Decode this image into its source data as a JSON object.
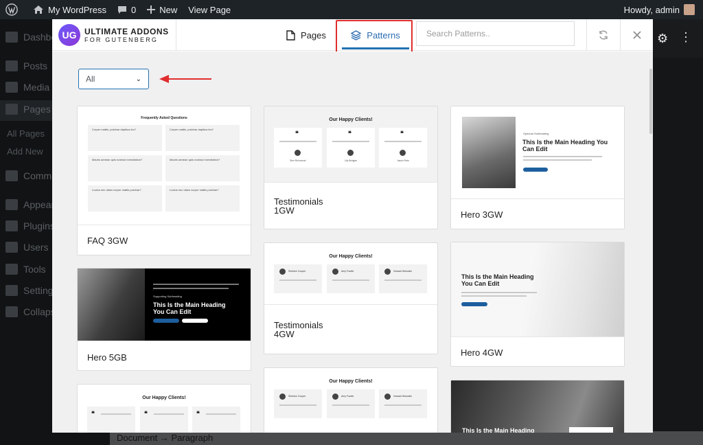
{
  "admin_bar": {
    "site_name": "My WordPress",
    "comments_count": "0",
    "new_label": "New",
    "view_label": "View Page",
    "greeting": "Howdy, admin"
  },
  "admin_menu": {
    "items": [
      "Dashboard",
      "Posts",
      "Media",
      "Pages",
      "Comments",
      "Appearance",
      "Plugins",
      "Users",
      "Tools",
      "Settings",
      "Collapse menu"
    ],
    "sub_items": [
      "All Pages",
      "Add New"
    ]
  },
  "editor": {
    "breadcrumb": "Document → Paragraph"
  },
  "modal": {
    "logo_badge": "UG",
    "logo_line1": "ULTIMATE ADDONS",
    "logo_line2": "FOR GUTENBERG",
    "tabs": [
      {
        "label": "Pages",
        "icon": "page-icon"
      },
      {
        "label": "Patterns",
        "icon": "layers-icon",
        "active": true
      }
    ],
    "search_placeholder": "Search Patterns..",
    "filter_value": "All",
    "highlight_color": "#e02d2d",
    "accent_color": "#2271b1"
  },
  "cards": [
    {
      "label": "FAQ 3GW",
      "preview": {
        "title": "Frequently Asked Questions",
        "questions": [
          "Corper mattis, pulvinar dapibus leo?",
          "Corper mattis, pulvinar dapibus leo?",
          "Mauris aenean quis nostrud exercitation?",
          "Mauris aenean quis nostrud exercitation?",
          "Luctus nec ullam corper mattis pulvinar?",
          "Luctus nec ullam corper mattis pulvinar?"
        ]
      }
    },
    {
      "label": "Testimonials 1GW",
      "preview": {
        "title": "Our Happy Clients!",
        "people": [
          "Ben Richmond",
          "Lily Bridges",
          "Jason Rain"
        ]
      }
    },
    {
      "label": "Hero 3GW",
      "preview": {
        "subheading": "Optional Subheading",
        "heading": "This Is the Main Heading You Can Edit"
      }
    },
    {
      "label": "Hero 5GB",
      "preview": {
        "subheading": "Supporting Subheading",
        "heading": "This Is the Main Heading You Can Edit"
      }
    },
    {
      "label": "Testimonials 4GW",
      "preview": {
        "title": "Our Happy Clients!",
        "people": [
          "Sheldon Cooper",
          "Amy Fowler",
          "Howard Wolowitz"
        ]
      }
    },
    {
      "label": "Hero 4GW",
      "preview": {
        "heading": "This Is the Main Heading You Can Edit"
      }
    },
    {
      "label": "",
      "preview": {
        "title": "Our Happy Clients!"
      }
    },
    {
      "label": "",
      "preview": {
        "title": "Our Happy Clients!",
        "people": [
          "Sheldon Cooper",
          "Amy Fowler",
          "Howard Wolowitz"
        ]
      }
    },
    {
      "label": "",
      "preview": {
        "heading": "This Is the Main Heading You Can Edit"
      }
    }
  ]
}
